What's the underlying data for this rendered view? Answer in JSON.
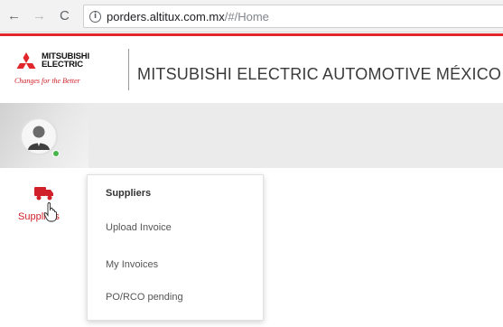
{
  "browser": {
    "back_icon": "arrow-left-icon",
    "forward_icon": "arrow-right-icon",
    "reload_icon": "reload-icon",
    "info_icon": "info-icon",
    "url_host": "porders.altitux.com.mx",
    "url_path": "/#/Home"
  },
  "header": {
    "logo_word_line1": "MITSUBISHI",
    "logo_word_line2": "ELECTRIC",
    "logo_tagline": "Changes for the Better",
    "title": "MITSUBISHI ELECTRIC AUTOMOTIVE MÉXICO",
    "accent_color": "#e1262c"
  },
  "sidebar": {
    "avatar_icon": "user-avatar-icon",
    "status_color": "#47b64a",
    "items": [
      {
        "label": "Suppliers",
        "icon": "truck-icon",
        "color": "#d0202a"
      }
    ]
  },
  "dropdown": {
    "title": "Suppliers",
    "items": [
      {
        "label": "Upload Invoice"
      },
      {
        "label": "My Invoices"
      },
      {
        "label": "PO/RCO pending"
      }
    ]
  }
}
